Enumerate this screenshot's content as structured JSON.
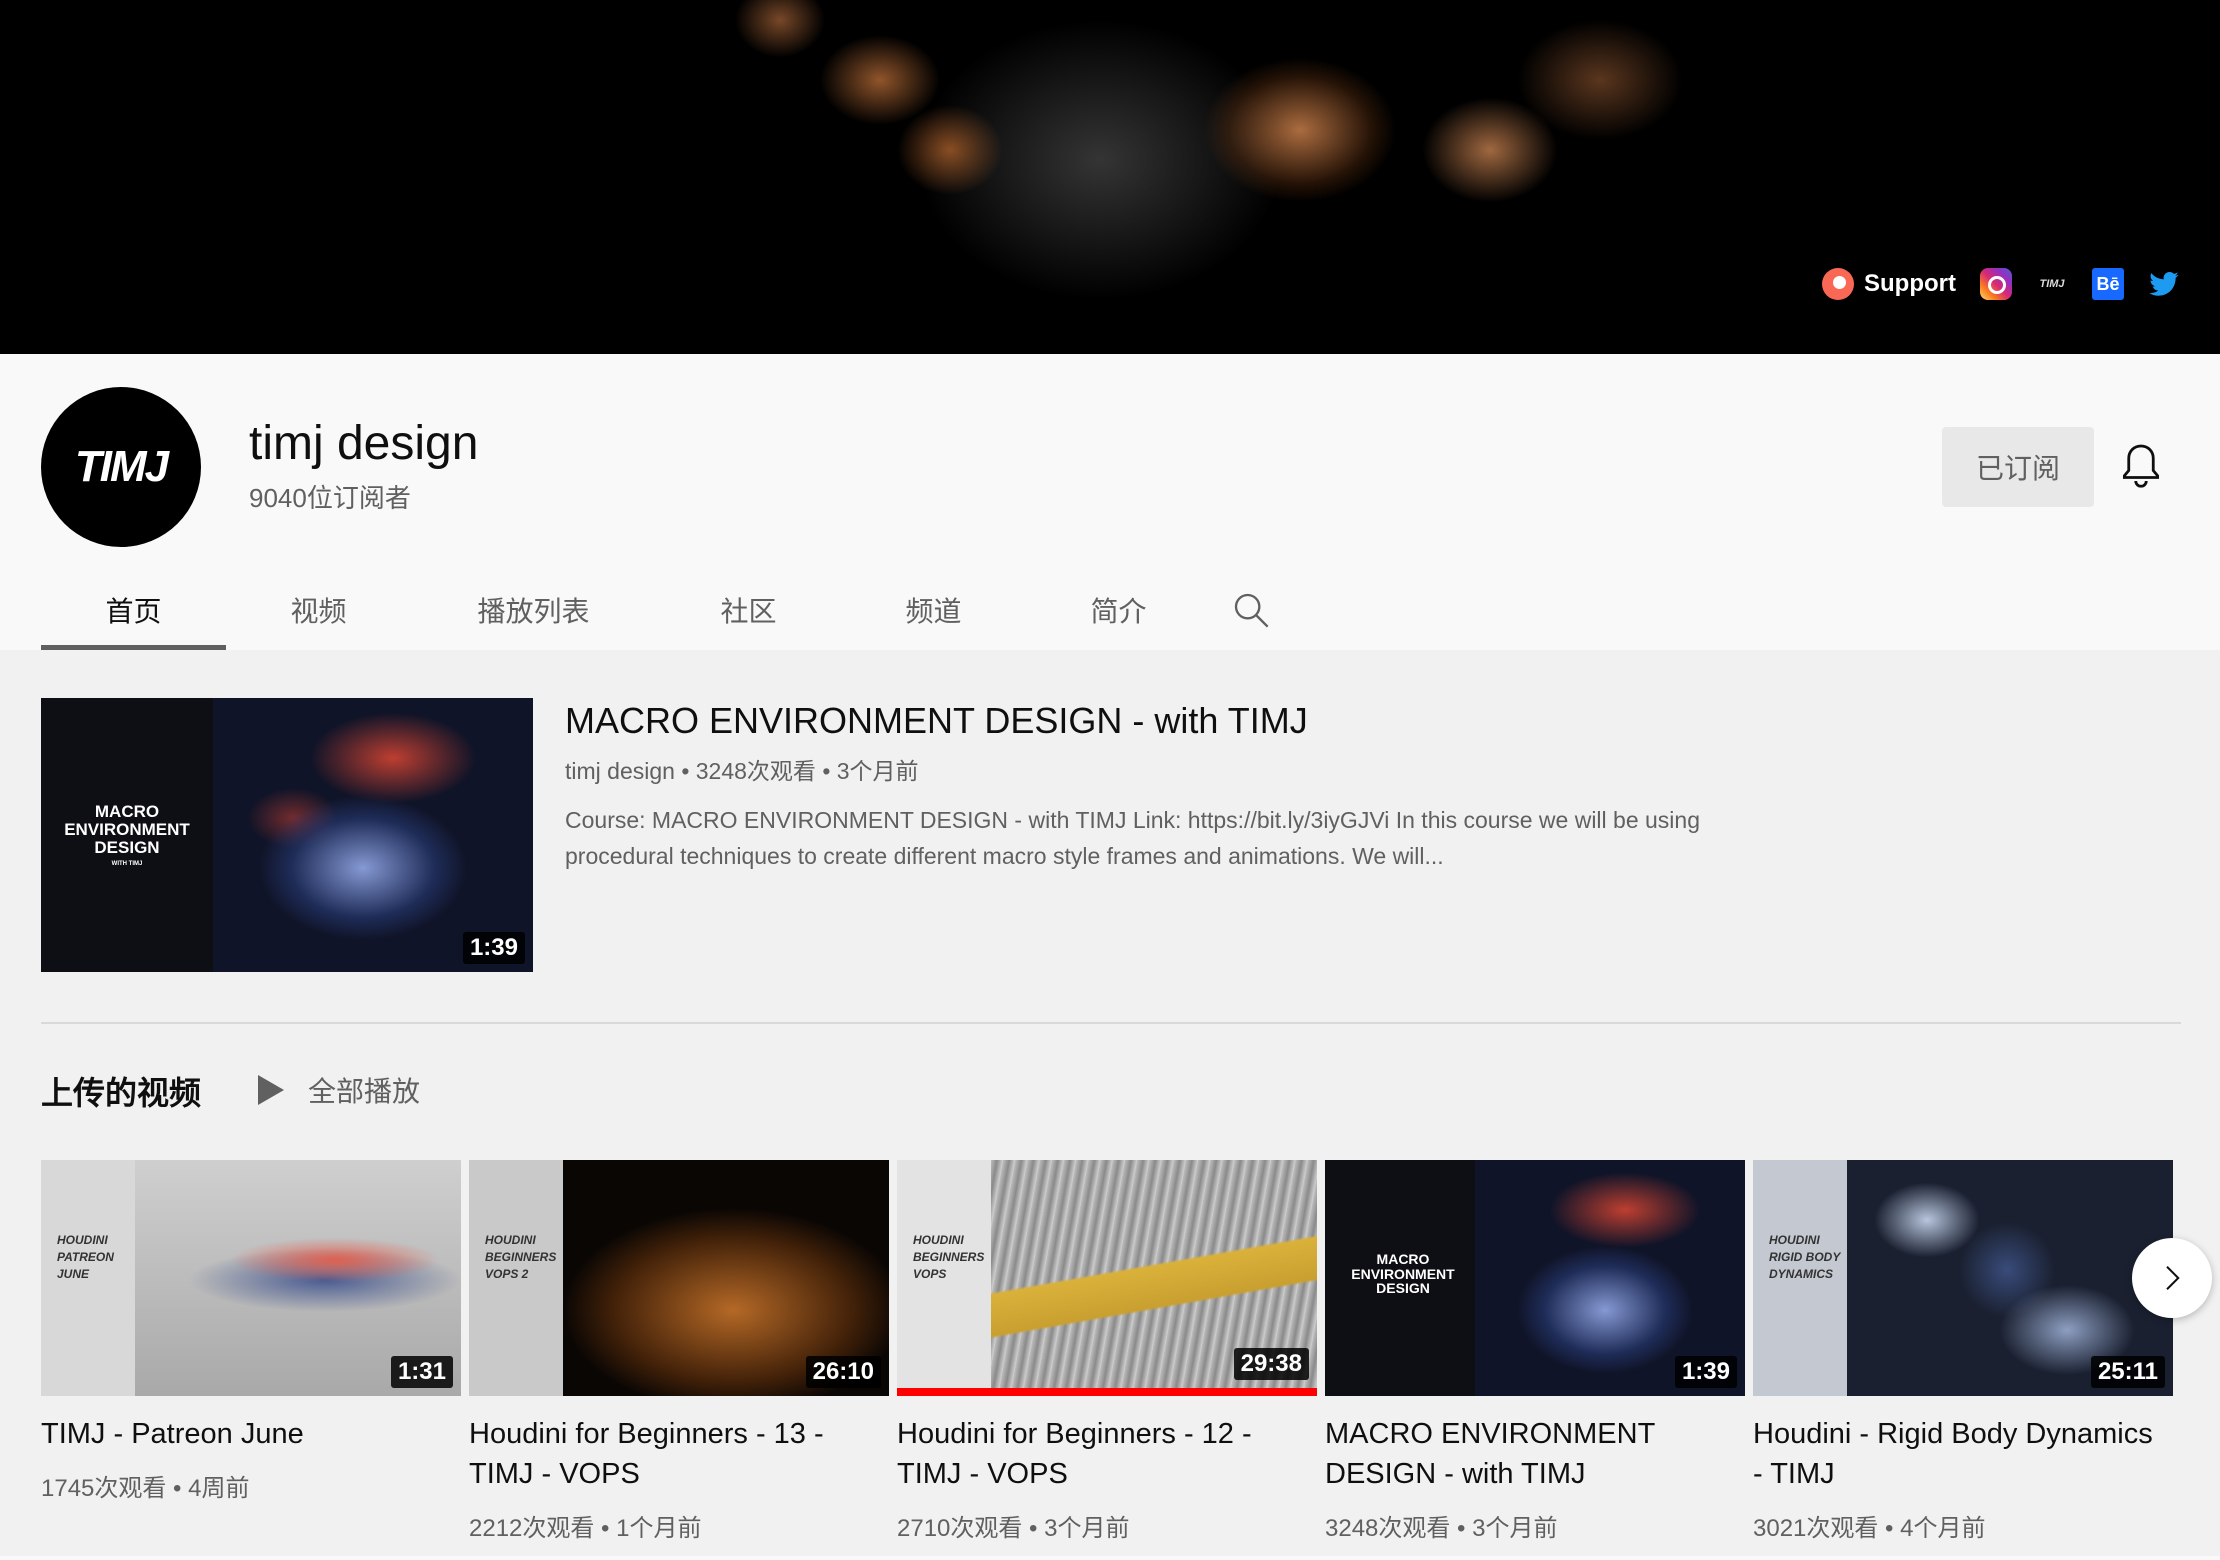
{
  "banner": {
    "support_label": "Support",
    "links": [
      "patreon-icon",
      "instagram-icon",
      "timj-icon",
      "behance-icon",
      "twitter-icon"
    ],
    "timj_mark": "TIMJ",
    "behance_mark": "Bē"
  },
  "channel": {
    "avatar_text": "TIMJ",
    "name": "timj design",
    "subscribers": "9040位订阅者",
    "subscribed_label": "已订阅"
  },
  "tabs": [
    {
      "label": "首页",
      "active": true
    },
    {
      "label": "视频",
      "active": false
    },
    {
      "label": "播放列表",
      "active": false
    },
    {
      "label": "社区",
      "active": false
    },
    {
      "label": "频道",
      "active": false
    },
    {
      "label": "简介",
      "active": false
    }
  ],
  "featured": {
    "thumb_text": "MACRO ENVIRONMENT DESIGN",
    "thumb_subtext": "WITH TIMJ",
    "duration": "1:39",
    "title": "MACRO ENVIRONMENT DESIGN - with TIMJ",
    "meta": "timj design • 3248次观看 • 3个月前",
    "description": "Course: MACRO ENVIRONMENT DESIGN - with TIMJ Link: https://bit.ly/3iyGJVi In this course we will be using procedural techniques to create different macro style frames and animations. We will..."
  },
  "uploads": {
    "section_title": "上传的视频",
    "play_all_label": "全部播放",
    "videos": [
      {
        "strip": "HOUDINI\nPATREON\nJUNE",
        "duration": "1:31",
        "title": "TIMJ - Patreon June",
        "meta": "1745次观看 • 4周前",
        "progress": 0
      },
      {
        "strip": "HOUDINI\nBEGINNERS\nVOPS 2",
        "duration": "26:10",
        "title": "Houdini for Beginners - 13 - TIMJ - VOPS",
        "meta": "2212次观看 • 1个月前",
        "progress": 0
      },
      {
        "strip": "HOUDINI\nBEGINNERS\nVOPS",
        "duration": "29:38",
        "title": "Houdini for Beginners - 12 - TIMJ - VOPS",
        "meta": "2710次观看 • 3个月前",
        "progress": 1
      },
      {
        "strip": "MACRO ENVIRONMENT DESIGN",
        "duration": "1:39",
        "title": "MACRO ENVIRONMENT DESIGN - with TIMJ",
        "meta": "3248次观看 • 3个月前",
        "progress": 0
      },
      {
        "strip": "HOUDINI\nRIGID BODY\nDYNAMICS",
        "duration": "25:11",
        "title": "Houdini - Rigid Body Dynamics - TIMJ",
        "meta": "3021次观看 • 4个月前",
        "progress": 0
      }
    ]
  },
  "colors": {
    "accent_red": "#ff0000",
    "text_secondary": "#606060"
  }
}
